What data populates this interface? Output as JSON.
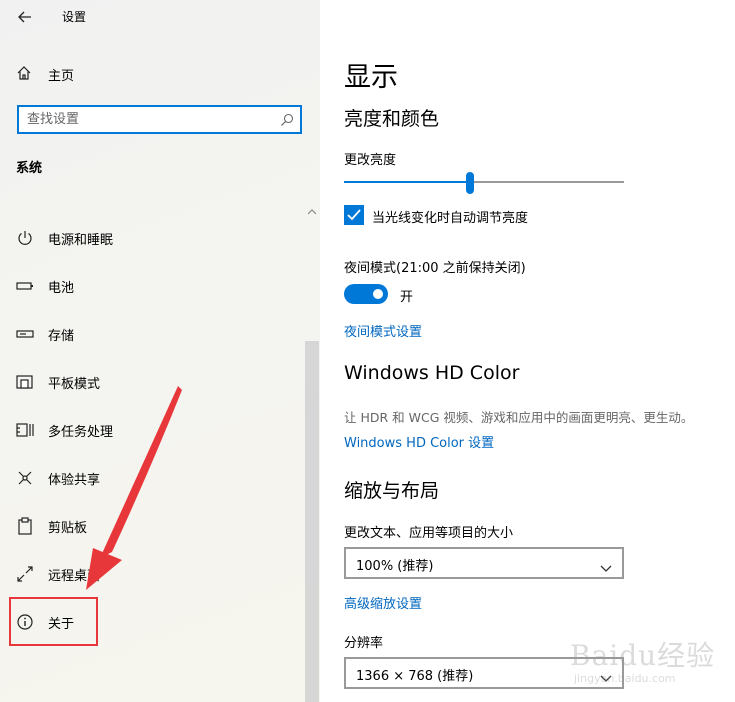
{
  "titlebar": {
    "title": "设置",
    "back_icon": "arrow-left-icon"
  },
  "sidebar": {
    "home_label": "主页",
    "search_placeholder": "查找设置",
    "section": "系统",
    "items": [
      {
        "label": "电源和睡眠",
        "icon": "power-icon"
      },
      {
        "label": "电池",
        "icon": "battery-icon"
      },
      {
        "label": "存储",
        "icon": "storage-icon"
      },
      {
        "label": "平板模式",
        "icon": "tablet-mode-icon"
      },
      {
        "label": "多任务处理",
        "icon": "multitasking-icon"
      },
      {
        "label": "体验共享",
        "icon": "shared-experiences-icon"
      },
      {
        "label": "剪贴板",
        "icon": "clipboard-icon"
      },
      {
        "label": "远程桌面",
        "icon": "remote-desktop-icon"
      },
      {
        "label": "关于",
        "icon": "info-icon",
        "highlighted": true
      }
    ]
  },
  "main": {
    "title": "显示",
    "brightness_section": "亮度和颜色",
    "brightness_label": "更改亮度",
    "brightness_value": 0.45,
    "auto_brightness_label": "当光线变化时自动调节亮度",
    "auto_brightness_checked": true,
    "night_mode_label": "夜间模式(21:00 之前保持关闭)",
    "night_mode_toggle": "开",
    "night_mode_on": true,
    "night_mode_link": "夜间模式设置",
    "hd_color_section": "Windows HD Color",
    "hd_color_desc": "让 HDR 和 WCG 视频、游戏和应用中的画面更明亮、更生动。",
    "hd_color_link": "Windows HD Color 设置",
    "scale_section": "缩放与布局",
    "scale_label": "更改文本、应用等项目的大小",
    "scale_value": "100% (推荐)",
    "advanced_scale_link": "高级缩放设置",
    "resolution_label": "分辨率",
    "resolution_value": "1366 × 768 (推荐)"
  },
  "watermark": {
    "text": "Baidu经验",
    "sub": "jingyan.baidu.com"
  },
  "colors": {
    "accent": "#0078d7",
    "link": "#0067c0",
    "annotation": "#e8373a"
  }
}
